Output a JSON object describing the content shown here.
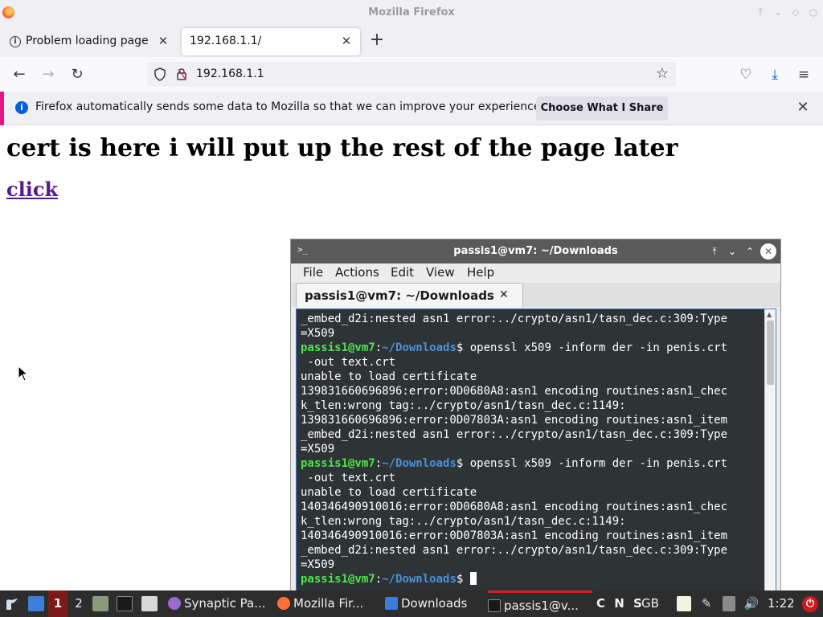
{
  "window": {
    "title": "Mozilla Firefox"
  },
  "tabs": [
    {
      "label": "Problem loading page",
      "icon": "info-icon",
      "active": false
    },
    {
      "label": "192.168.1.1/",
      "active": true
    }
  ],
  "navbar": {
    "url": "192.168.1.1"
  },
  "notification": {
    "text": "Firefox automatically sends some data to Mozilla so that we can improve your experience.",
    "button_label": "Choose What I Share",
    "accent_color": "#e31587"
  },
  "page": {
    "heading": "cert is here i will put up the rest of the page later",
    "link": "click",
    "link_color": "#551a8b"
  },
  "terminal": {
    "title": "passis1@vm7: ~/Downloads",
    "menu": [
      "File",
      "Actions",
      "Edit",
      "View",
      "Help"
    ],
    "tab_label": "passis1@vm7: ~/Downloads",
    "prompt": {
      "user": "passis1@vm7",
      "sep": ":",
      "path": "~/Downloads",
      "symbol": "$"
    },
    "lines": [
      {
        "text": "_embed_d2i:nested asn1 error:../crypto/asn1/tasn_dec.c:309:Type"
      },
      {
        "text": "=X509"
      },
      {
        "prompt": true,
        "text": " openssl x509 -inform der -in penis.crt"
      },
      {
        "text": " -out text.crt"
      },
      {
        "text": "unable to load certificate"
      },
      {
        "text": "139831660696896:error:0D0680A8:asn1 encoding routines:asn1_chec"
      },
      {
        "text": "k_tlen:wrong tag:../crypto/asn1/tasn_dec.c:1149:"
      },
      {
        "text": "139831660696896:error:0D07803A:asn1 encoding routines:asn1_item"
      },
      {
        "text": "_embed_d2i:nested asn1 error:../crypto/asn1/tasn_dec.c:309:Type"
      },
      {
        "text": "=X509"
      },
      {
        "prompt": true,
        "text": " openssl x509 -inform der -in penis.crt"
      },
      {
        "text": " -out text.crt"
      },
      {
        "text": "unable to load certificate"
      },
      {
        "text": "140346490910016:error:0D0680A8:asn1 encoding routines:asn1_chec"
      },
      {
        "text": "k_tlen:wrong tag:../crypto/asn1/tasn_dec.c:1149:"
      },
      {
        "text": "140346490910016:error:0D07803A:asn1 encoding routines:asn1_item"
      },
      {
        "text": "_embed_d2i:nested asn1 error:../crypto/asn1/tasn_dec.c:309:Type"
      },
      {
        "text": "=X509"
      },
      {
        "prompt": true,
        "text": " ",
        "cursor": true
      }
    ],
    "colors": {
      "background": "#2e3436",
      "prompt_user": "#4ee44e",
      "prompt_path": "#4a90d9"
    }
  },
  "taskbar": {
    "workspaces": [
      "1",
      "2"
    ],
    "tasks": [
      {
        "label": "Synaptic Pa...",
        "icon": "synaptic-icon"
      },
      {
        "label": "Mozilla Fir...",
        "icon": "firefox-icon"
      },
      {
        "label": "Downloads",
        "icon": "folder-icon"
      },
      {
        "label": "passis1@v...",
        "icon": "terminal-icon",
        "active": true
      }
    ],
    "keyboard_state": "C N S",
    "keyboard_layout": "GB",
    "clock": "1:22"
  }
}
